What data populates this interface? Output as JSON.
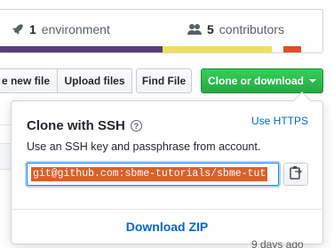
{
  "summary": {
    "environments_count": "1",
    "environments_label": "environment",
    "contributors_count": "5",
    "contributors_label": "contributors"
  },
  "language_bar": [
    {
      "share": 50.5,
      "color": "#563d7c"
    },
    {
      "share": 33.9,
      "color": "#f1e05a"
    },
    {
      "share": 3.6,
      "color": "#ffffff"
    },
    {
      "share": 5.3,
      "color": "#e34c26"
    },
    {
      "share": 6.7,
      "color": "#ffffff"
    }
  ],
  "toolbar": {
    "new_file_label": "e new file",
    "upload_label": "Upload files",
    "find_label": "Find File",
    "clone_label": "Clone or download"
  },
  "clone_dropdown": {
    "title": "Clone with SSH",
    "help_glyph": "?",
    "use_https_label": "Use HTTPS",
    "description": "Use an SSH key and passphrase from account.",
    "url_value": "git@github.com:sbme-tutorials/sbme-tut",
    "download_zip_label": "Download ZIP"
  },
  "background": {
    "time_text": "9 days ago"
  },
  "colors": {
    "accent_green": "#28a745",
    "link_blue": "#0366d6",
    "selection": "#d9602a"
  }
}
